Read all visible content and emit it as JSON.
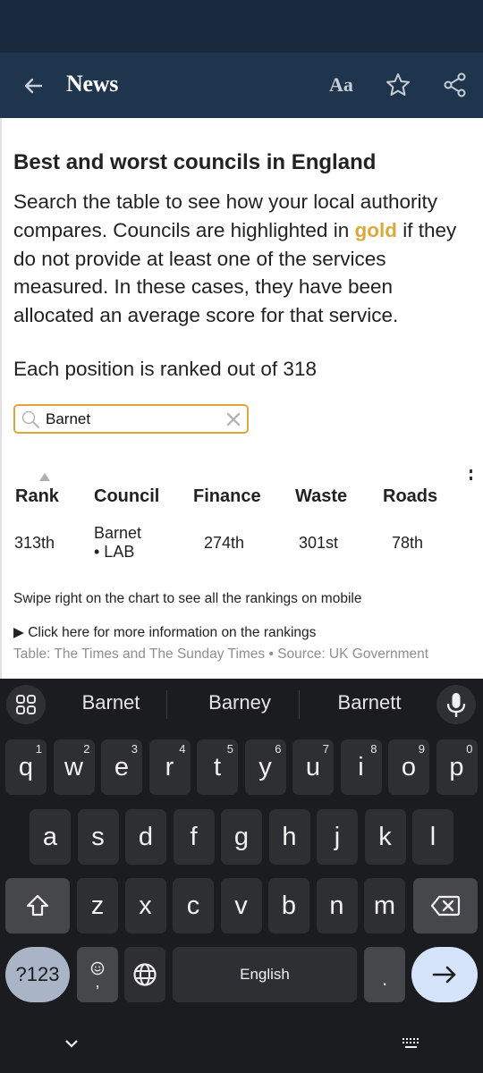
{
  "app_bar": {
    "title": "News",
    "font_size_label": "Aa",
    "icons": [
      "back-arrow-icon",
      "font-size-icon",
      "star-icon",
      "share-icon"
    ]
  },
  "article": {
    "headline": "Best and worst councils in England",
    "description_before": "Search the table to see how your local authority compares. Councils are highlighted in ",
    "description_highlight": "gold",
    "description_after": " if they do not provide at least one of the services measured. In these cases, they have been allocated an average score for that service.",
    "highlight_color": "#d9a93a",
    "ranked_note": "Each position is ranked out of 318"
  },
  "search": {
    "value": "Barnet",
    "placeholder": "",
    "accent_color": "#e0a53a"
  },
  "table": {
    "columns": [
      "Rank",
      "Council",
      "Finance",
      "Waste",
      "Roads"
    ],
    "sorted_column": "Rank",
    "rows": [
      {
        "rank": "313th",
        "council": "Barnet",
        "party": "• LAB",
        "finance": "274th",
        "waste": "301st",
        "roads": "78th"
      }
    ]
  },
  "notes": {
    "swipe": "Swipe right on the chart to see all the rankings on mobile",
    "more_info": "▶ Click here for more information on the rankings",
    "source": "Table: The Times and The Sunday Times • Source: UK Government"
  },
  "keyboard": {
    "suggestions": [
      "Barnet",
      "Barney",
      "Barnett"
    ],
    "row1": [
      {
        "k": "q",
        "n": "1"
      },
      {
        "k": "w",
        "n": "2"
      },
      {
        "k": "e",
        "n": "3"
      },
      {
        "k": "r",
        "n": "4"
      },
      {
        "k": "t",
        "n": "5"
      },
      {
        "k": "y",
        "n": "6"
      },
      {
        "k": "u",
        "n": "7"
      },
      {
        "k": "i",
        "n": "8"
      },
      {
        "k": "o",
        "n": "9"
      },
      {
        "k": "p",
        "n": "0"
      }
    ],
    "row2": [
      "a",
      "s",
      "d",
      "f",
      "g",
      "h",
      "j",
      "k",
      "l"
    ],
    "row3": [
      "z",
      "x",
      "c",
      "v",
      "b",
      "n",
      "m"
    ],
    "symbols_label": "?123",
    "comma_label": ",",
    "space_label": "English",
    "period_label": "."
  }
}
